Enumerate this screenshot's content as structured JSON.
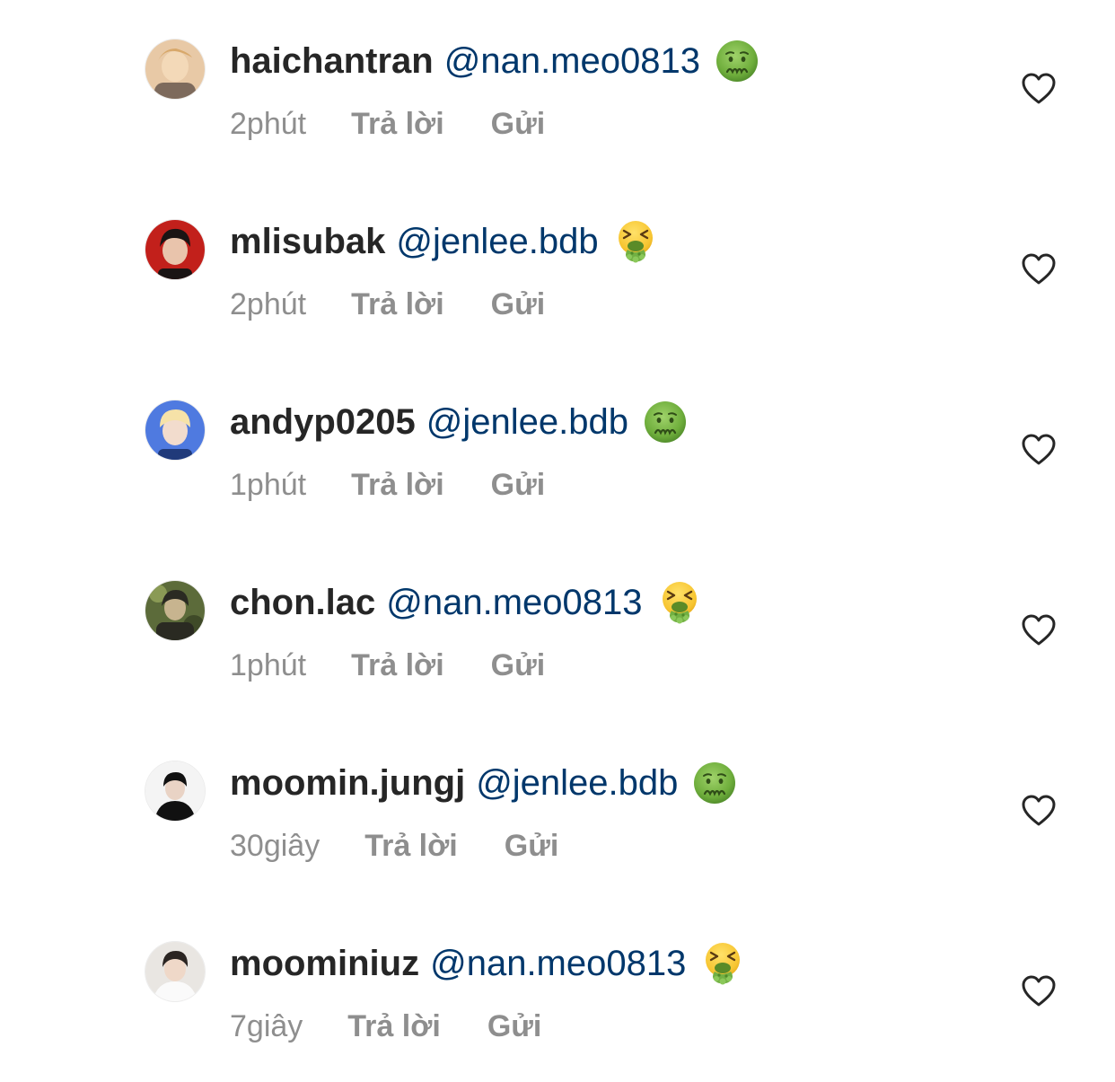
{
  "comments": [
    {
      "username": "haichantran",
      "mention": "@nan.meo0813",
      "emoji": "nauseated-face",
      "time": "2phút",
      "reply_label": "Trả lời",
      "send_label": "Gửi",
      "avatar_colors": [
        "#e8c9a6",
        "#f3d9b8",
        "#7d6a5c"
      ]
    },
    {
      "username": "mlisubak",
      "mention": "@jenlee.bdb",
      "emoji": "vomiting-face",
      "time": "2phút",
      "reply_label": "Trả lời",
      "send_label": "Gửi",
      "avatar_colors": [
        "#c2201b",
        "#1a1414",
        "#e9c4ac"
      ]
    },
    {
      "username": "andyp0205",
      "mention": "@jenlee.bdb",
      "emoji": "nauseated-face",
      "time": "1phút",
      "reply_label": "Trả lời",
      "send_label": "Gửi",
      "avatar_colors": [
        "#4f7ae0",
        "#f2dccd",
        "#f6e2a8"
      ]
    },
    {
      "username": "chon.lac",
      "mention": "@nan.meo0813",
      "emoji": "vomiting-face",
      "time": "1phút",
      "reply_label": "Trả lời",
      "send_label": "Gửi",
      "avatar_colors": [
        "#5c6b3a",
        "#2a2a22",
        "#c7b48f"
      ]
    },
    {
      "username": "moomin.jungj",
      "mention": "@jenlee.bdb",
      "emoji": "nauseated-face",
      "time": "30giây",
      "reply_label": "Trả lời",
      "send_label": "Gửi",
      "avatar_colors": [
        "#f4f4f4",
        "#111111",
        "#e9d3c5"
      ]
    },
    {
      "username": "moominiuz",
      "mention": "@nan.meo0813",
      "emoji": "vomiting-face",
      "time": "7giây",
      "reply_label": "Trả lời",
      "send_label": "Gửi",
      "avatar_colors": [
        "#e9e6e2",
        "#2b2522",
        "#efd8c8"
      ]
    }
  ],
  "colors": {
    "text": "#262626",
    "mention": "#00376b",
    "meta": "#8e8e8e",
    "heart_stroke": "#262626"
  }
}
